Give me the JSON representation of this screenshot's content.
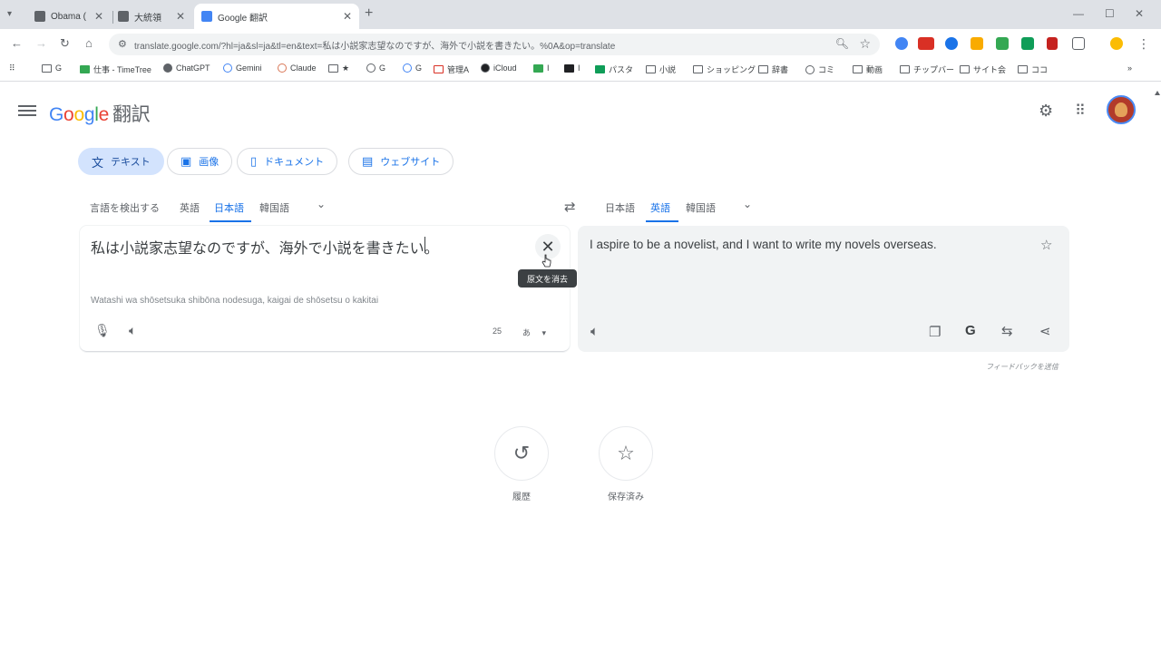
{
  "browser": {
    "tabs": [
      {
        "title": "Obama (",
        "active": false
      },
      {
        "title": "大統領",
        "active": false
      },
      {
        "title": "Google 翻訳",
        "active": true
      }
    ],
    "url": "translate.google.com/?hl=ja&sl=ja&tl=en&text=私は小説家志望なのですが、海外で小説を書きたい。%0A&op=translate",
    "bookmarks": [
      "G",
      "仕事 - TimeTree",
      "ChatGPT",
      "Gemini",
      "Claude",
      "★",
      "G",
      "G",
      "管理A",
      "iCloud",
      "I",
      "I",
      "パスタ",
      "小説",
      "ショッピング",
      "辞書",
      "コミ",
      "動画",
      "チップバー",
      "サイト会",
      "ココ"
    ]
  },
  "header": {
    "logo_google": "Google",
    "logo_translate": "翻訳"
  },
  "modes": {
    "text": "テキスト",
    "image": "画像",
    "document": "ドキュメント",
    "website": "ウェブサイト"
  },
  "source_langs": {
    "detect": "言語を検出する",
    "english": "英語",
    "japanese": "日本語",
    "korean": "韓国語"
  },
  "target_langs": {
    "japanese": "日本語",
    "english": "英語",
    "korean": "韓国語"
  },
  "source": {
    "text": "私は小説家志望なのですが、海外で小説を書きたい。",
    "romanization": "Watashi wa shōsetsuka shibōna nodesuga, kaigai de shōsetsu o kakitai",
    "char_count": "25",
    "font_label": "あ",
    "tooltip": "原文を消去"
  },
  "target": {
    "text": "I aspire to be a novelist, and I want to write my novels overseas.",
    "feedback": "フィードバックを送信"
  },
  "bottom": {
    "history": "履歴",
    "saved": "保存済み"
  },
  "icons": {
    "history": "history-icon",
    "saved": "star-icon"
  }
}
